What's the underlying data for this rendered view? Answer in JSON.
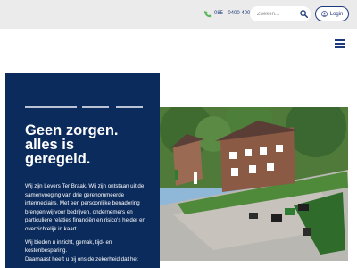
{
  "header": {
    "phone": "085 - 0400 400",
    "search_placeholder": "Zoeken...",
    "login_label": "Login",
    "icons": [
      "phone-icon",
      "search-icon",
      "user-icon",
      "hamburger-menu-icon"
    ]
  },
  "hero": {
    "headline_lines": [
      "Geen zorgen.",
      "alles is",
      "geregeld."
    ],
    "paragraph1": "Wij zijn Levers Ter Braak. Wij zijn ontstaan uit de samenvoeging van drie gerenommeerde intermediairs. Met een persoonlijke benadering brengen wij voor bedrijven, ondernemers en particuliere relaties financiën en risico's helder en overzichtelijk in kaart.",
    "paragraph2_line1": "Wij bieden u inzicht, gemak, tijd- en kostenbesparing.",
    "paragraph2_line2": "Daarnaast heeft u bij ons de zekerheid dat het"
  },
  "colors": {
    "brand_navy": "#0b2b5c",
    "accent_green": "#5cb85c",
    "topbar_gray": "#ebebeb"
  }
}
